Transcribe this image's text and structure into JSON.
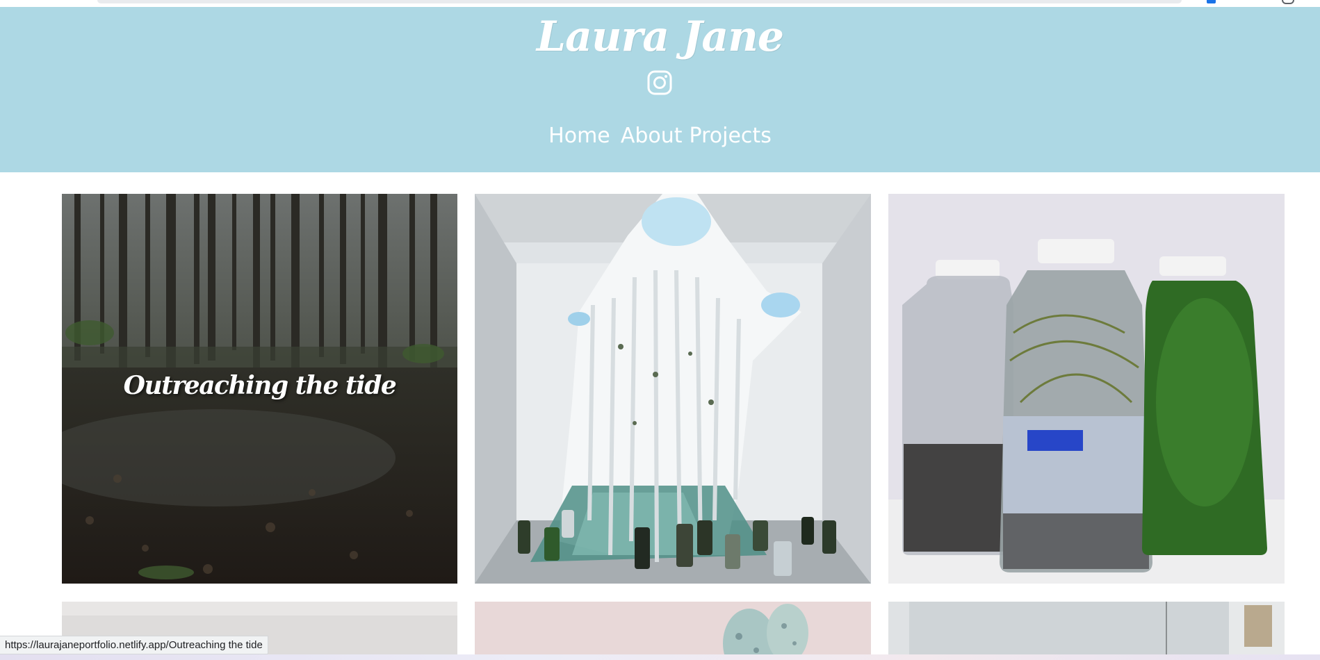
{
  "site": {
    "brand": "Laura Jane",
    "social": {
      "instagram_icon": "instagram-icon"
    },
    "nav": [
      "Home",
      "About",
      "Projects"
    ],
    "colors": {
      "header_bg": "#add8e4",
      "text": "#ffffff"
    }
  },
  "gallery": {
    "tiles": [
      {
        "title": "Outreaching the tide",
        "image": "forest-puddle-photo"
      },
      {
        "title": "",
        "image": "hanging-fabric-installation-photo"
      },
      {
        "title": "",
        "image": "three-bottles-with-plants-photo"
      },
      {
        "title": "",
        "image": "white-wall-photo"
      },
      {
        "title": "",
        "image": "ceramic-eggs-photo"
      },
      {
        "title": "",
        "image": "interior-room-photo"
      }
    ]
  },
  "status_bar": {
    "url": "https://laurajaneportfolio.netlify.app/Outreaching the tide"
  }
}
